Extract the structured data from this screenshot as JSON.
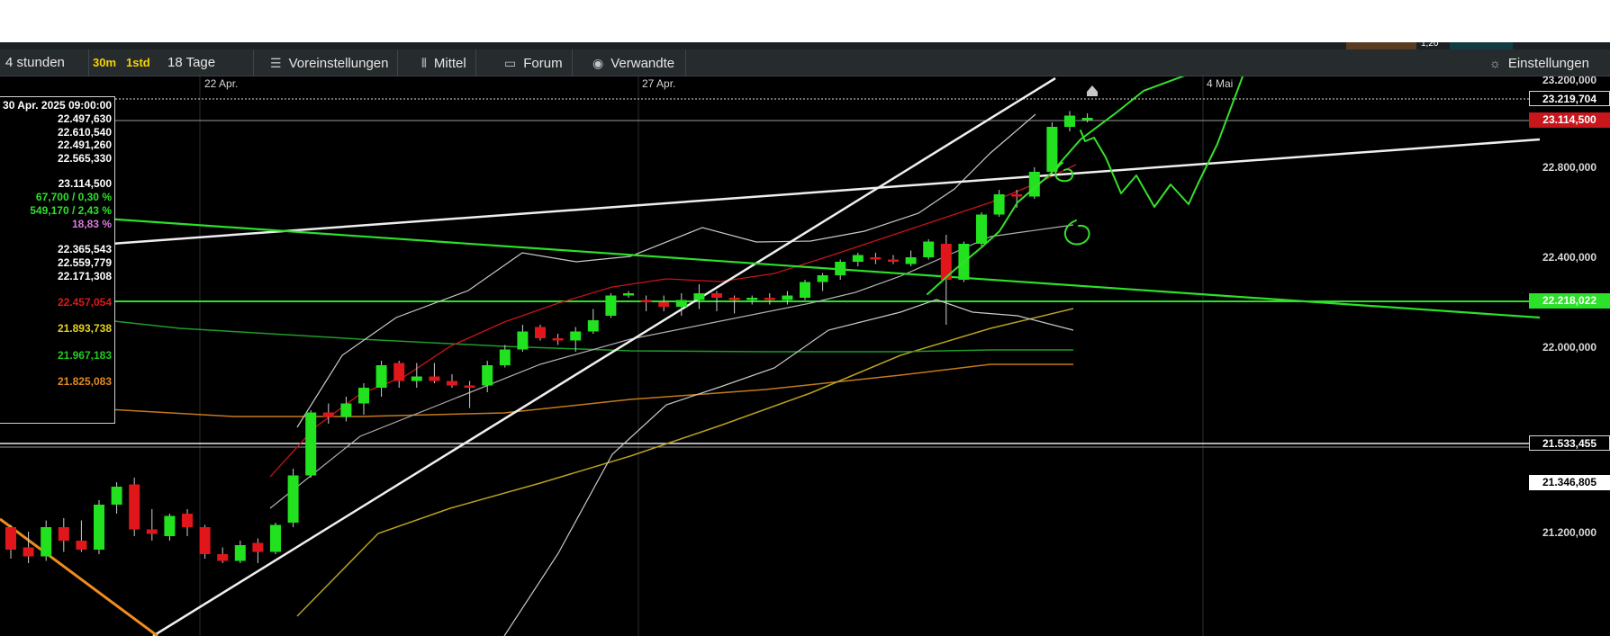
{
  "toolbar": {
    "period": "4 stunden",
    "interval_30m": "30m",
    "interval_1std": "1std",
    "range": "18 Tage",
    "presets": "Voreinstellungen",
    "average": "Mittel",
    "forum": "Forum",
    "related": "Verwandte",
    "settings": "Einstellungen",
    "top_value": "1,20"
  },
  "infobox": {
    "datetime": "30 Apr. 2025 09:00:00",
    "open": "22.497,630",
    "high": "22.610,540",
    "low": "22.491,260",
    "close": "22.565,330",
    "last": "23.114,500",
    "change_abs": "67,700 / 0,30 %",
    "change_period": "549,170 / 2,43 %",
    "pct": "18,83 %",
    "bb_upper": "22.365,543",
    "bb_mid": "22.559,779",
    "bb_lower": "22.171,308",
    "ma_red": "22.457,054",
    "ma_yellow": "21.893,738",
    "ma_green": "21.967,183",
    "ma_orange": "21.825,083"
  },
  "price_labels": {
    "top_cut": "23.200,000",
    "dotted": "23.219,704",
    "current": "23.114,500",
    "green_line": "22.218,022",
    "white_line": "21.533,455",
    "lower_white": "21.346,805"
  },
  "colors": {
    "up": "#22e11f",
    "down": "#e0161b",
    "current_bg": "#c8161d",
    "green_line": "#2de02a"
  },
  "chart_data": {
    "type": "candlestick",
    "x_ticks": [
      "22 Apr.",
      "27 Apr.",
      "4 Mai"
    ],
    "y_ticks": [
      23200,
      22800,
      22400,
      22000,
      21200
    ],
    "ylim": [
      21150,
      23310
    ],
    "candles": [
      {
        "o": 21300,
        "h": 21310,
        "l": 21160,
        "c": 21200
      },
      {
        "o": 21210,
        "h": 21280,
        "l": 21140,
        "c": 21170
      },
      {
        "o": 21170,
        "h": 21330,
        "l": 21150,
        "c": 21300
      },
      {
        "o": 21300,
        "h": 21340,
        "l": 21190,
        "c": 21240
      },
      {
        "o": 21240,
        "h": 21330,
        "l": 21190,
        "c": 21200
      },
      {
        "o": 21200,
        "h": 21420,
        "l": 21180,
        "c": 21400
      },
      {
        "o": 21400,
        "h": 21500,
        "l": 21360,
        "c": 21480
      },
      {
        "o": 21490,
        "h": 21520,
        "l": 21260,
        "c": 21290
      },
      {
        "o": 21290,
        "h": 21380,
        "l": 21240,
        "c": 21270
      },
      {
        "o": 21260,
        "h": 21360,
        "l": 21240,
        "c": 21350
      },
      {
        "o": 21360,
        "h": 21380,
        "l": 21260,
        "c": 21300
      },
      {
        "o": 21300,
        "h": 21310,
        "l": 21160,
        "c": 21180
      },
      {
        "o": 21180,
        "h": 21210,
        "l": 21140,
        "c": 21150
      },
      {
        "o": 21150,
        "h": 21240,
        "l": 21140,
        "c": 21220
      },
      {
        "o": 21230,
        "h": 21250,
        "l": 21140,
        "c": 21190
      },
      {
        "o": 21190,
        "h": 21320,
        "l": 21180,
        "c": 21310
      },
      {
        "o": 21320,
        "h": 21560,
        "l": 21300,
        "c": 21530
      },
      {
        "o": 21530,
        "h": 21820,
        "l": 21520,
        "c": 21810
      },
      {
        "o": 21810,
        "h": 21850,
        "l": 21760,
        "c": 21790
      },
      {
        "o": 21790,
        "h": 21880,
        "l": 21770,
        "c": 21850
      },
      {
        "o": 21850,
        "h": 21940,
        "l": 21800,
        "c": 21920
      },
      {
        "o": 21920,
        "h": 22040,
        "l": 21880,
        "c": 22020
      },
      {
        "o": 22030,
        "h": 22040,
        "l": 21920,
        "c": 21950
      },
      {
        "o": 21950,
        "h": 22030,
        "l": 21920,
        "c": 21970
      },
      {
        "o": 21970,
        "h": 22030,
        "l": 21940,
        "c": 21950
      },
      {
        "o": 21950,
        "h": 21980,
        "l": 21920,
        "c": 21930
      },
      {
        "o": 21930,
        "h": 21950,
        "l": 21830,
        "c": 21920
      },
      {
        "o": 21930,
        "h": 22040,
        "l": 21900,
        "c": 22020
      },
      {
        "o": 22020,
        "h": 22110,
        "l": 22010,
        "c": 22090
      },
      {
        "o": 22090,
        "h": 22200,
        "l": 22080,
        "c": 22170
      },
      {
        "o": 22190,
        "h": 22200,
        "l": 22130,
        "c": 22140
      },
      {
        "o": 22140,
        "h": 22160,
        "l": 22110,
        "c": 22130
      },
      {
        "o": 22130,
        "h": 22190,
        "l": 22080,
        "c": 22170
      },
      {
        "o": 22170,
        "h": 22270,
        "l": 22160,
        "c": 22220
      },
      {
        "o": 22240,
        "h": 22340,
        "l": 22230,
        "c": 22330
      },
      {
        "o": 22330,
        "h": 22350,
        "l": 22320,
        "c": 22340
      },
      {
        "o": 22310,
        "h": 22330,
        "l": 22260,
        "c": 22300
      },
      {
        "o": 22300,
        "h": 22330,
        "l": 22260,
        "c": 22280
      },
      {
        "o": 22280,
        "h": 22340,
        "l": 22240,
        "c": 22310
      },
      {
        "o": 22310,
        "h": 22380,
        "l": 22270,
        "c": 22340
      },
      {
        "o": 22340,
        "h": 22350,
        "l": 22260,
        "c": 22320
      },
      {
        "o": 22320,
        "h": 22330,
        "l": 22250,
        "c": 22310
      },
      {
        "o": 22310,
        "h": 22330,
        "l": 22290,
        "c": 22320
      },
      {
        "o": 22320,
        "h": 22340,
        "l": 22290,
        "c": 22310
      },
      {
        "o": 22310,
        "h": 22350,
        "l": 22290,
        "c": 22330
      },
      {
        "o": 22320,
        "h": 22400,
        "l": 22310,
        "c": 22390
      },
      {
        "o": 22390,
        "h": 22430,
        "l": 22350,
        "c": 22420
      },
      {
        "o": 22420,
        "h": 22490,
        "l": 22400,
        "c": 22480
      },
      {
        "o": 22480,
        "h": 22520,
        "l": 22460,
        "c": 22510
      },
      {
        "o": 22500,
        "h": 22520,
        "l": 22470,
        "c": 22490
      },
      {
        "o": 22490,
        "h": 22510,
        "l": 22470,
        "c": 22480
      },
      {
        "o": 22470,
        "h": 22530,
        "l": 22460,
        "c": 22500
      },
      {
        "o": 22500,
        "h": 22580,
        "l": 22490,
        "c": 22570
      },
      {
        "o": 22560,
        "h": 22600,
        "l": 22200,
        "c": 22400
      },
      {
        "o": 22400,
        "h": 22570,
        "l": 22390,
        "c": 22560
      },
      {
        "o": 22560,
        "h": 22700,
        "l": 22550,
        "c": 22690
      },
      {
        "o": 22690,
        "h": 22800,
        "l": 22680,
        "c": 22780
      },
      {
        "o": 22780,
        "h": 22800,
        "l": 22720,
        "c": 22770
      },
      {
        "o": 22770,
        "h": 22900,
        "l": 22760,
        "c": 22880
      },
      {
        "o": 22880,
        "h": 23100,
        "l": 22870,
        "c": 23080
      },
      {
        "o": 23080,
        "h": 23150,
        "l": 23060,
        "c": 23130
      },
      {
        "o": 23110,
        "h": 23140,
        "l": 23100,
        "c": 23120
      }
    ]
  }
}
